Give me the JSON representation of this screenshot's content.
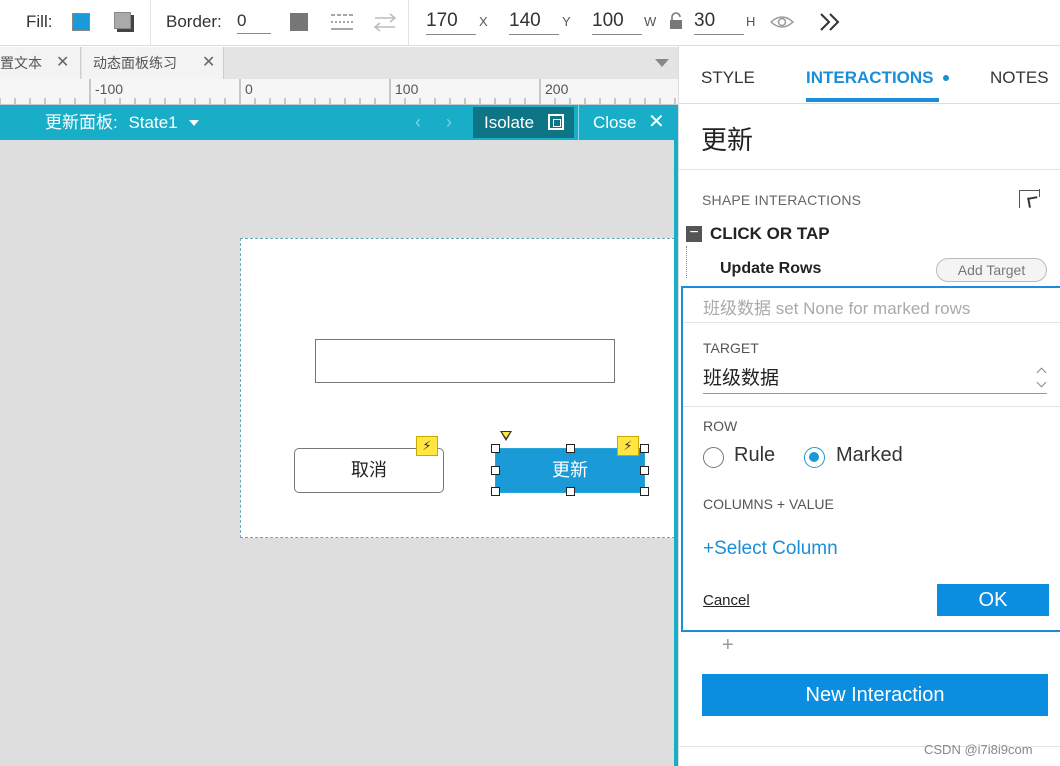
{
  "toolbar": {
    "fill_label": "Fill:",
    "border_label": "Border:",
    "border_value": "0",
    "x_value": "170",
    "x_unit": "X",
    "y_value": "140",
    "y_unit": "Y",
    "w_value": "100",
    "w_unit": "W",
    "h_value": "30",
    "h_unit": "H",
    "fill_color": "#1a9ad6",
    "border_color": "#777777"
  },
  "doc_tabs": [
    {
      "label": "置文本"
    },
    {
      "label": "动态面板练习"
    }
  ],
  "ruler": {
    "labels": [
      "-100",
      "0",
      "100",
      "200"
    ]
  },
  "state_bar": {
    "title": "更新面板:",
    "state": "State1",
    "isolate_label": "Isolate",
    "close_label": "Close",
    "prev_arrow": "‹",
    "next_arrow": "›",
    "color": "#18aec8"
  },
  "canvas": {
    "cancel_button_label": "取消",
    "update_button_label": "更新"
  },
  "right_panel": {
    "tabs": [
      {
        "label": "STYLE",
        "active": false
      },
      {
        "label": "INTERACTIONS",
        "active": true
      },
      {
        "label": "NOTES",
        "active": false
      }
    ],
    "shape_name": "更新",
    "shape_interactions_label": "SHAPE INTERACTIONS",
    "event_label": "CLICK OR TAP",
    "action_label": "Update Rows",
    "add_target_label": "Add Target",
    "editor": {
      "summary": "班级数据 set None for marked rows",
      "target_label": "TARGET",
      "target_value": "班级数据",
      "row_label": "ROW",
      "row_options": [
        {
          "label": "Rule",
          "selected": false
        },
        {
          "label": "Marked",
          "selected": true
        }
      ],
      "columns_label": "COLUMNS + VALUE",
      "select_column_label": "+Select Column",
      "cancel_label": "Cancel",
      "ok_label": "OK"
    },
    "add_plus": "+",
    "new_interaction_label": "New Interaction",
    "accent_color": "#0c8ee0"
  },
  "watermark": "CSDN @i7i8i9com"
}
